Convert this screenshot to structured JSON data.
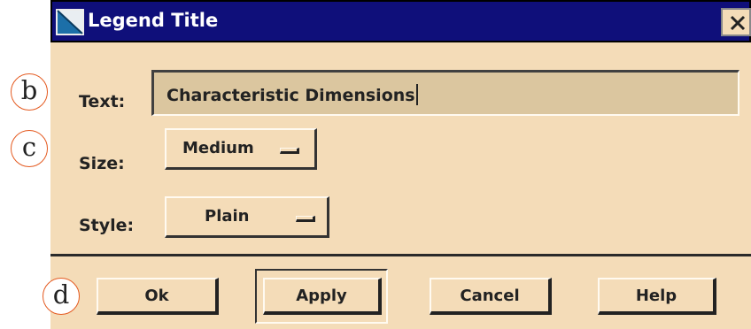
{
  "window": {
    "title": "Legend Title",
    "close_glyph": "✕"
  },
  "fields": {
    "text_label": "Text:",
    "text_value": "Characteristic Dimensions",
    "size_label": "Size:",
    "size_value": "Medium",
    "style_label": "Style:",
    "style_value": "Plain"
  },
  "buttons": {
    "ok": "Ok",
    "apply": "Apply",
    "cancel": "Cancel",
    "help": "Help"
  },
  "callouts": {
    "b": "b",
    "c": "c",
    "d": "d"
  },
  "icons": {
    "window_icon": "app-window-icon",
    "close": "close-icon",
    "option_indicator": "option-menu-indicator-icon"
  },
  "colors": {
    "dialog_bg": "#f4dcb8",
    "titlebar_bg": "#0f0f7a",
    "field_bg": "#dbc69f",
    "callout_border": "#e45a20"
  }
}
